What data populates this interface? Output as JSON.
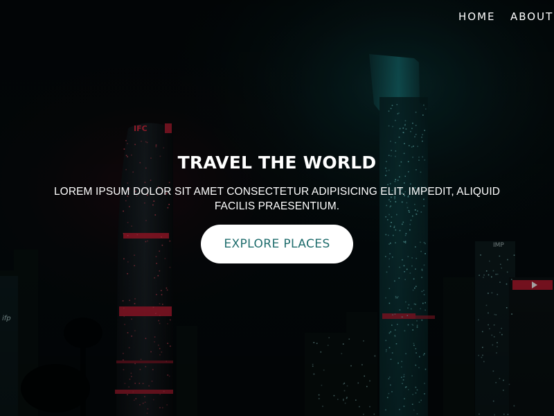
{
  "nav": {
    "items": [
      {
        "label": "HOME"
      },
      {
        "label": "ABOUT"
      }
    ]
  },
  "hero": {
    "title": "TRAVEL THE WORLD",
    "subtitle": "LOREM IPSUM DOLOR SIT AMET CONSECTETUR ADIPISICING ELIT. IMPEDIT, ALIQUID FACILIS PRAESENTIUM.",
    "button_label": "EXPLORE PLACES"
  },
  "background": {
    "signs": [
      "IFC",
      "IMP",
      "ifp"
    ]
  },
  "colors": {
    "accent": "#1f6d6d",
    "overlay": "#030708",
    "tower_glow": "#1d8b8e",
    "neon_red": "#e0203a"
  }
}
